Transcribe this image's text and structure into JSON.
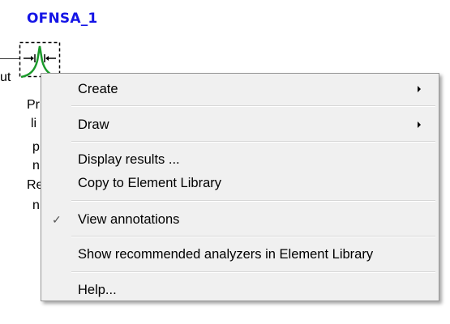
{
  "element": {
    "name": "OFNSA_1",
    "port_label": "ut"
  },
  "background_text": [
    "Pr",
    "li",
    "p",
    "n",
    "Re",
    "n"
  ],
  "context_menu": {
    "items": [
      {
        "label": "Create",
        "submenu": true
      },
      {
        "label": "Draw",
        "submenu": true
      },
      {
        "label": "Display results ..."
      },
      {
        "label": "Copy to Element Library"
      },
      {
        "label": "View annotations",
        "checked": true,
        "check_mark": "✓"
      },
      {
        "label": "Show recommended analyzers in Element Library"
      },
      {
        "label": "Help..."
      }
    ]
  },
  "colors": {
    "element_name": "#1414e6",
    "symbol_curve": "#1a9a2a",
    "menu_background": "#f0f0f0"
  }
}
